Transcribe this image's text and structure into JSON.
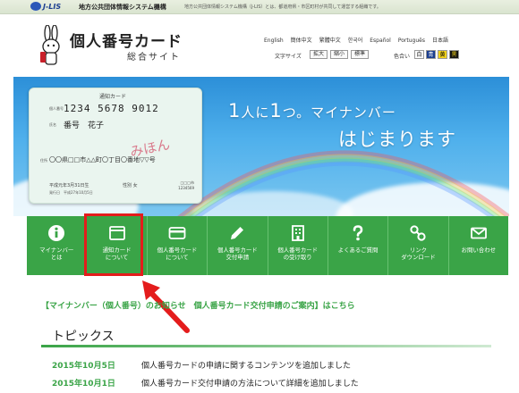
{
  "topbar": {
    "logo_text": "J-LIS",
    "org_name": "地方公共団体情報システム機構",
    "description": "地方公共団体情報システム機構（J-LIS）とは、都道府県・市区町村が共同して運営する組織です。"
  },
  "header": {
    "title": "個人番号カード",
    "subtitle": "総合サイト",
    "languages": [
      "English",
      "簡体中文",
      "繁體中文",
      "한국어",
      "Español",
      "Português",
      "日本語"
    ],
    "fontsize_label": "文字サイズ",
    "fontsize_buttons": [
      "拡大",
      "縮小",
      "標準"
    ],
    "color_label": "色合い",
    "color_buttons": [
      {
        "label": "白",
        "bg": "#ffffff",
        "fg": "#000000"
      },
      {
        "label": "青",
        "bg": "#1a3d8f",
        "fg": "#ffffff"
      },
      {
        "label": "黄",
        "bg": "#f2d21b",
        "fg": "#000000"
      },
      {
        "label": "黒",
        "bg": "#111111",
        "fg": "#f2d21b"
      }
    ]
  },
  "hero": {
    "card": {
      "header": "通知カード",
      "number_label": "個人番号",
      "number": "1234 5678 9012",
      "name_label": "氏名",
      "name": "番号　花子",
      "address_label": "住所",
      "address": "〇〇県□□市△△町〇丁目〇番地▽▽号",
      "watermark": "みほん",
      "birth": "平成元年3月31日生",
      "sex_label": "性別",
      "sex": "女",
      "expiry": "発行日　平成27年10月5日",
      "code_box": "□□□市\n1234569"
    },
    "headline_part1": "1",
    "headline_part2": "人に",
    "headline_part3": "1",
    "headline_part4": "つ。マイナンバー",
    "headline_line2": "はじまります"
  },
  "nav": {
    "items": [
      {
        "line1": "マイナンバー",
        "line2": "とは",
        "icon": "info-icon"
      },
      {
        "line1": "通知カード",
        "line2": "について",
        "icon": "window-icon"
      },
      {
        "line1": "個人番号カード",
        "line2": "について",
        "icon": "card-icon"
      },
      {
        "line1": "個人番号カード",
        "line2": "交付申請",
        "icon": "pencil-icon"
      },
      {
        "line1": "個人番号カード",
        "line2": "の受け取り",
        "icon": "building-icon"
      },
      {
        "line1": "よくあるご質問",
        "line2": "",
        "icon": "question-icon"
      },
      {
        "line1": "リンク",
        "line2": "ダウンロード",
        "icon": "link-icon"
      },
      {
        "line1": "お問い合わせ",
        "line2": "",
        "icon": "mail-icon"
      }
    ]
  },
  "news_link": "【マイナンバー（個人番号）のお知らせ　個人番号カード交付申請のご案内】はこちら",
  "topics": {
    "title": "トピックス",
    "items": [
      {
        "date": "2015年10月5日",
        "text": "個人番号カードの申請に関するコンテンツを追加しました"
      },
      {
        "date": "2015年10月1日",
        "text": "個人番号カード交付申請の方法について詳細を追加しました"
      }
    ]
  },
  "colors": {
    "nav_green": "#3aa447",
    "highlight_red": "#e41c1c",
    "sky_blue": "#2c8fd8"
  }
}
